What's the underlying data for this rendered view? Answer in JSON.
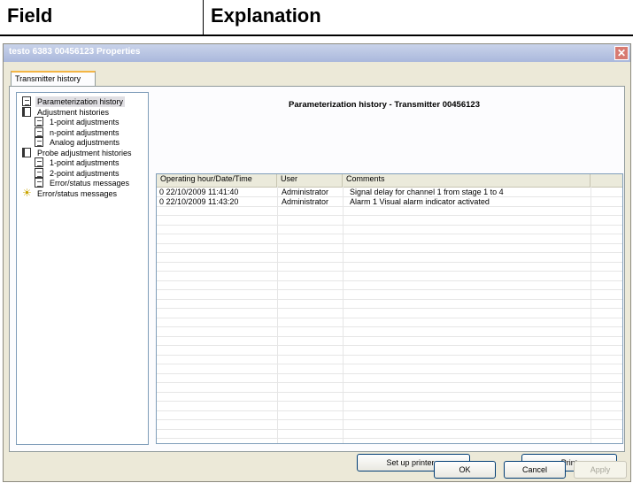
{
  "doc_header": {
    "col1": "Field",
    "col2": "Explanation"
  },
  "window": {
    "title": "testo 6383  00456123 Properties",
    "close_glyph": "✕"
  },
  "tab": {
    "label": "Transmitter history"
  },
  "tree": {
    "items": [
      {
        "label": "Parameterization history",
        "icon": "doc-icon",
        "indent": 0,
        "selected": true
      },
      {
        "label": "Adjustment histories",
        "icon": "book-icon",
        "indent": 0
      },
      {
        "label": "1-point adjustments",
        "icon": "doc-icon",
        "indent": 1
      },
      {
        "label": "n-point adjustments",
        "icon": "doc-icon",
        "indent": 1
      },
      {
        "label": "Analog adjustments",
        "icon": "doc-icon",
        "indent": 1
      },
      {
        "label": "Probe adjustment histories",
        "icon": "book-icon",
        "indent": 0
      },
      {
        "label": "1-point adjustments",
        "icon": "doc-icon",
        "indent": 1
      },
      {
        "label": "2-point adjustments",
        "icon": "doc-icon",
        "indent": 1
      },
      {
        "label": "Error/status messages",
        "icon": "doc-icon",
        "indent": 1
      },
      {
        "label": "Error/status messages",
        "icon": "bug-icon",
        "indent": 0
      }
    ]
  },
  "panel": {
    "title": "Parameterization history - Transmitter 00456123"
  },
  "table": {
    "columns": [
      "Operating hour/Date/Time",
      "User",
      "Comments"
    ],
    "rows": [
      [
        "0 22/10/2009 11:41:40",
        "Administrator",
        "Signal delay for channel 1 from stage 1 to 4"
      ],
      [
        "0 22/10/2009 11:43:20",
        "Administrator",
        "Alarm 1 Visual alarm indicator activated"
      ]
    ]
  },
  "buttons": {
    "setup_printer": "Set up printer...",
    "print": "Print",
    "ok": "OK",
    "cancel": "Cancel",
    "apply": "Apply"
  }
}
